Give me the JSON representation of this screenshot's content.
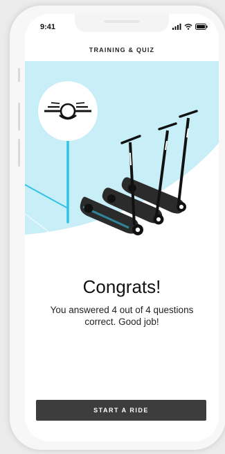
{
  "status_bar": {
    "time": "9:41"
  },
  "header": {
    "title": "TRAINING & QUIZ"
  },
  "illustration": {
    "logo_icon": "bird-wings-logo",
    "subject": "three-scooters-icon",
    "background_color": "#c8eef7",
    "accent_color": "#33c2e4"
  },
  "result": {
    "heading": "Congrats!",
    "message": "You answered 4 out of 4 questions correct. Good job!",
    "correct": 4,
    "total": 4
  },
  "actions": {
    "start_ride_label": "START A RIDE",
    "button_color": "#3d3d3d"
  }
}
